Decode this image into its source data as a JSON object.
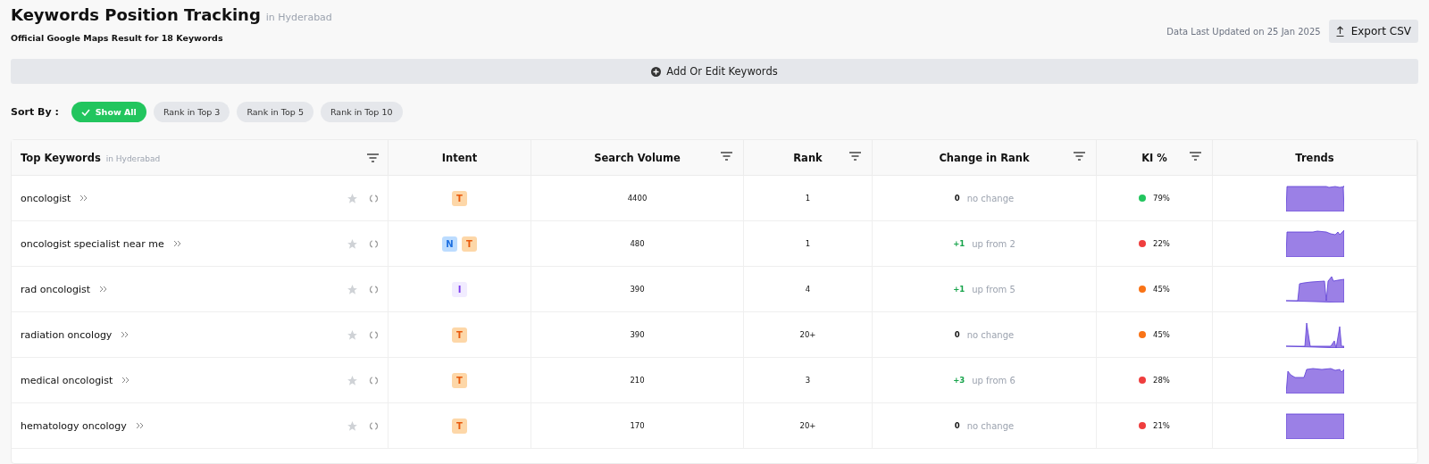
{
  "header": {
    "title": "Keywords Position Tracking",
    "location": "in Hyderabad",
    "subtitle": "Official Google Maps Result for 18 Keywords",
    "updated": "Data Last Updated on 25 Jan 2025",
    "export_button": "Export CSV"
  },
  "add_bar": {
    "label": "Add Or Edit Keywords"
  },
  "sort": {
    "label": "Sort By :",
    "options": [
      {
        "label": "Show All",
        "selected": true
      },
      {
        "label": "Rank in Top 3",
        "selected": false
      },
      {
        "label": "Rank in Top 5",
        "selected": false
      },
      {
        "label": "Rank in Top 10",
        "selected": false
      }
    ]
  },
  "table": {
    "columns": [
      {
        "label": "Top Keywords",
        "suffix": "in Hyderabad",
        "filter": true
      },
      {
        "label": "Intent",
        "filter": false
      },
      {
        "label": "Search Volume",
        "filter": true
      },
      {
        "label": "Rank",
        "filter": true
      },
      {
        "label": "Change in Rank",
        "filter": true
      },
      {
        "label": "KI %",
        "filter": true
      },
      {
        "label": "Trends",
        "filter": false
      }
    ],
    "rows": [
      {
        "keyword": "oncologist",
        "intents": [
          {
            "label": "T",
            "kind": "transactional"
          }
        ],
        "volume": "4400",
        "rank": "1",
        "change": {
          "delta": "0",
          "note": "no change",
          "kind": "none"
        },
        "ki": "79%",
        "color": "#22c55e"
      },
      {
        "keyword": "oncologist specialist near me",
        "intents": [
          {
            "label": "N",
            "kind": "navigational"
          },
          {
            "label": "T",
            "kind": "transactional"
          }
        ],
        "volume": "480",
        "rank": "1",
        "change": {
          "delta": "+1",
          "note": "up from 2",
          "kind": "up"
        },
        "ki": "22%",
        "color": "#ef3e3e"
      },
      {
        "keyword": "rad oncologist",
        "intents": [
          {
            "label": "I",
            "kind": "informational"
          }
        ],
        "volume": "390",
        "rank": "4",
        "change": {
          "delta": "+1",
          "note": "up from 5",
          "kind": "up"
        },
        "ki": "45%",
        "color": "#f97316"
      },
      {
        "keyword": "radiation oncology",
        "intents": [
          {
            "label": "T",
            "kind": "transactional"
          }
        ],
        "volume": "390",
        "rank": "20+",
        "change": {
          "delta": "0",
          "note": "no change",
          "kind": "none"
        },
        "ki": "45%",
        "color": "#f97316"
      },
      {
        "keyword": "medical oncologist",
        "intents": [
          {
            "label": "T",
            "kind": "transactional"
          }
        ],
        "volume": "210",
        "rank": "3",
        "change": {
          "delta": "+3",
          "note": "up from 6",
          "kind": "up"
        },
        "ki": "28%",
        "color": "#ef3e3e"
      },
      {
        "keyword": "hematology oncology",
        "intents": [
          {
            "label": "T",
            "kind": "transactional"
          }
        ],
        "volume": "170",
        "rank": "20+",
        "change": {
          "delta": "0",
          "note": "no change",
          "kind": "none"
        },
        "ki": "21%",
        "color": "#ef3e3e"
      }
    ]
  }
}
